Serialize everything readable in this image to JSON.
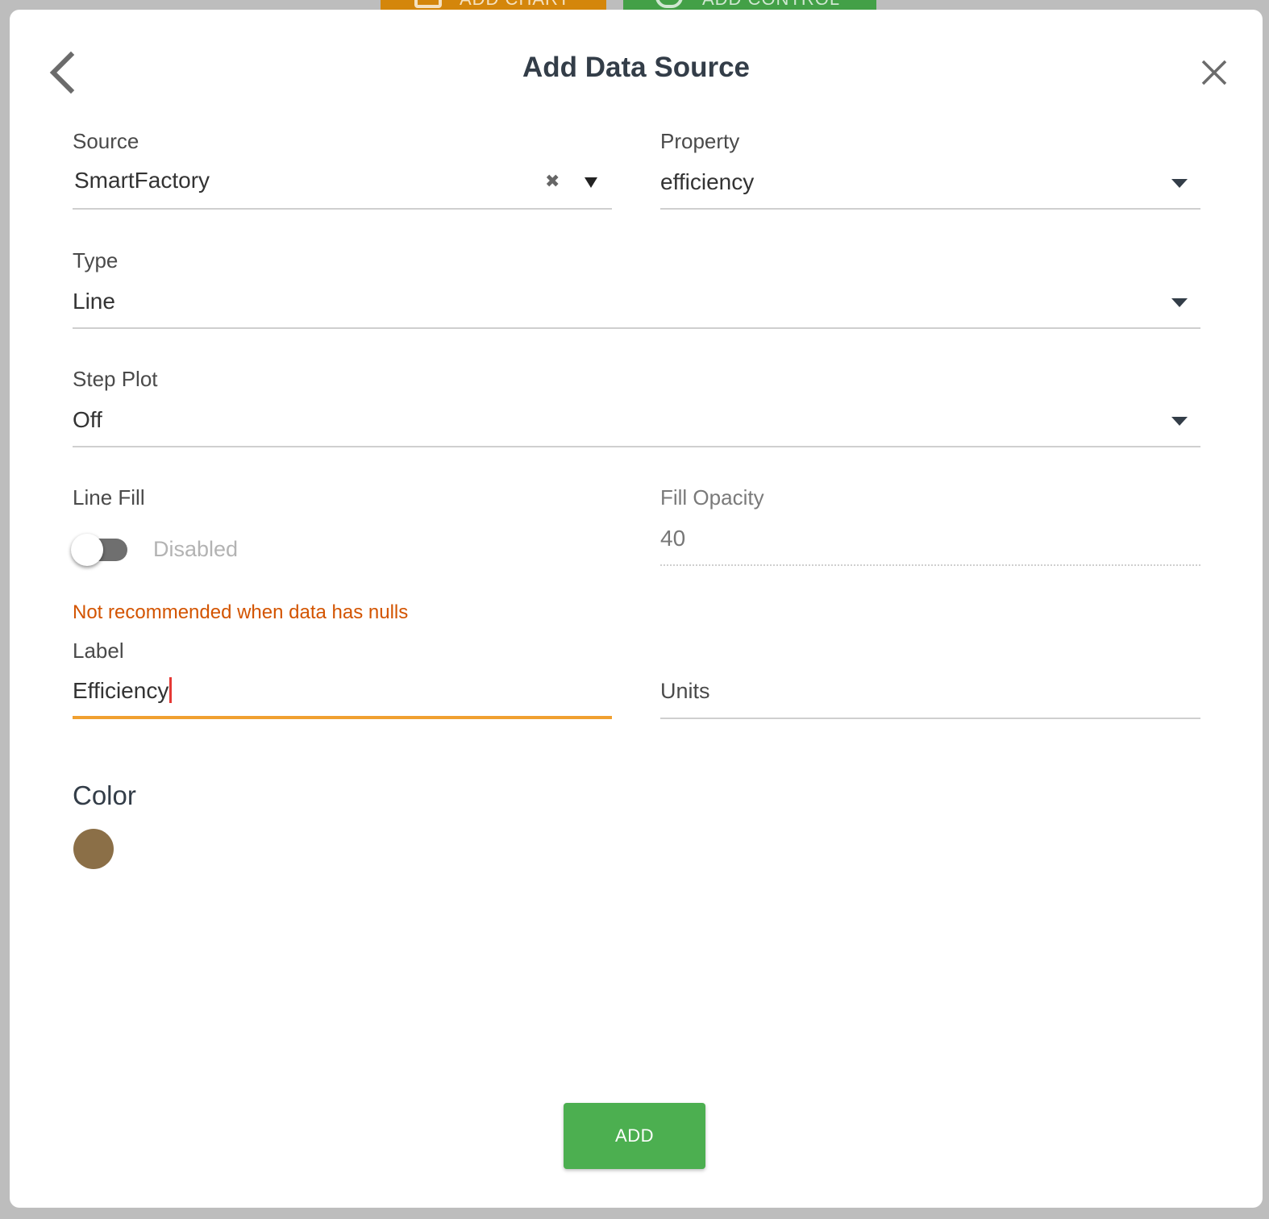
{
  "background_buttons": {
    "add_chart": "ADD CHART",
    "add_control": "ADD CONTROL"
  },
  "dialog": {
    "title": "Add Data Source",
    "icons": {
      "back": "chevron-left-icon",
      "close": "close-icon"
    }
  },
  "form": {
    "source": {
      "label": "Source",
      "value": "SmartFactory"
    },
    "property": {
      "label": "Property",
      "value": "efficiency"
    },
    "type": {
      "label": "Type",
      "value": "Line"
    },
    "step_plot": {
      "label": "Step Plot",
      "value": "Off"
    },
    "line_fill": {
      "label": "Line Fill",
      "state_text": "Disabled",
      "enabled": false
    },
    "fill_opacity": {
      "label": "Fill Opacity",
      "value": "40"
    },
    "warning": "Not recommended when data has nulls",
    "label": {
      "label": "Label",
      "value": "Efficiency"
    },
    "units": {
      "placeholder": "Units",
      "value": ""
    },
    "color": {
      "title": "Color",
      "value": "#8b6f47"
    }
  },
  "actions": {
    "add_label": "ADD"
  },
  "colors": {
    "accent_orange": "#f0a030",
    "warning": "#d35400",
    "add_button": "#4caf50",
    "title_text": "#333d48"
  }
}
